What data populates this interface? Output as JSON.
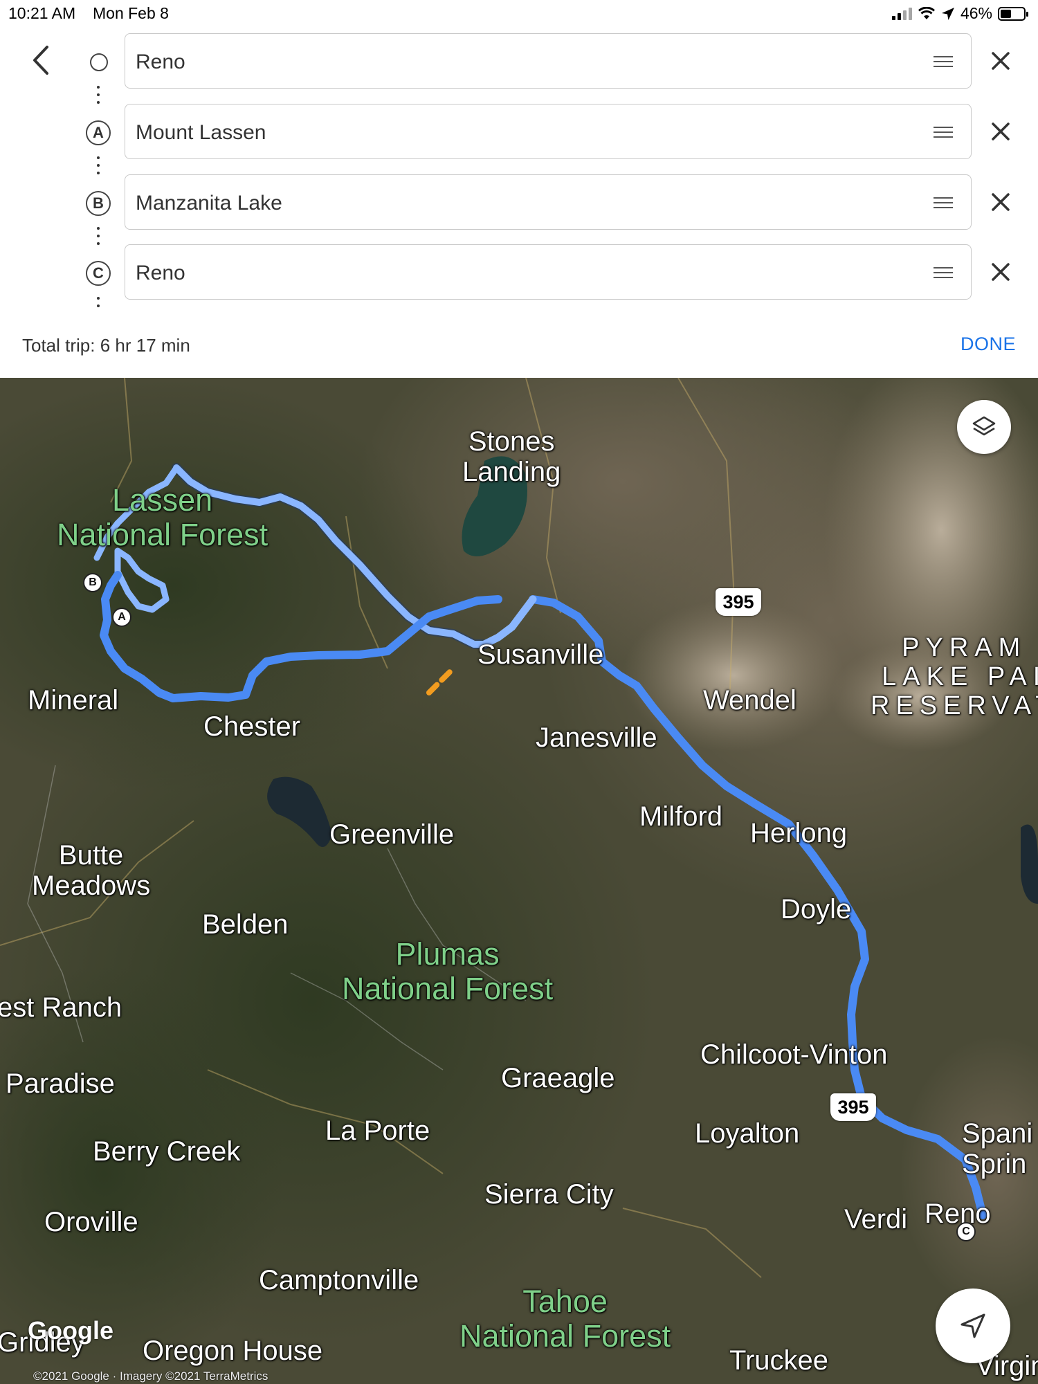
{
  "status_bar": {
    "time": "10:21 AM",
    "date": "Mon Feb 8",
    "battery": "46%",
    "battery_level": 0.46
  },
  "route": {
    "stops": [
      {
        "marker": "",
        "value": "Reno"
      },
      {
        "marker": "A",
        "value": "Mount Lassen"
      },
      {
        "marker": "B",
        "value": "Manzanita Lake"
      },
      {
        "marker": "C",
        "value": "Reno"
      }
    ],
    "total_trip": "Total trip: 6 hr 17 min",
    "done_label": "DONE"
  },
  "map": {
    "places": {
      "stones_landing": "Stones\nLanding",
      "lassen_nf": "Lassen\nNational Forest",
      "susanville": "Susanville",
      "pyramid_lake": "PYRAM\nLAKE PAI\nRESERVAT",
      "wendel": "Wendel",
      "mineral": "Mineral",
      "chester": "Chester",
      "janesville": "Janesville",
      "milford": "Milford",
      "herlong": "Herlong",
      "greenville": "Greenville",
      "butte_meadows": "Butte\nMeadows",
      "doyle": "Doyle",
      "belden": "Belden",
      "plumas_nf": "Plumas\nNational Forest",
      "forest_ranch": "est Ranch",
      "chilcoot_vinton": "Chilcoot-Vinton",
      "paradise": "Paradise",
      "graeagle": "Graeagle",
      "la_porte": "La Porte",
      "loyalton": "Loyalton",
      "spanish_springs": "Spani\nSprin",
      "berry_creek": "Berry Creek",
      "sierra_city": "Sierra City",
      "verdi": "Verdi",
      "reno": "Reno",
      "oroville": "Oroville",
      "camptonville": "Camptonville",
      "tahoe_nf": "Tahoe\nNational Forest",
      "gridley": "Gridley",
      "oregon_house": "Oregon House",
      "truckee": "Truckee",
      "virginia": "Virgini"
    },
    "highway_shields": [
      "395",
      "395"
    ],
    "pins": [
      "A",
      "B",
      "C"
    ],
    "attribution_logo": "Google",
    "copyright": "©2021 Google · Imagery ©2021 TerraMetrics"
  },
  "icons": {
    "back": "chevron-left-icon",
    "drag": "drag-handle-icon",
    "remove": "close-icon",
    "layers": "layers-icon",
    "locate": "navigation-arrow-icon"
  },
  "colors": {
    "route": "#4285f4",
    "route_light": "#7fb2ff",
    "done": "#1a73e8",
    "forest_label": "#7fd089"
  }
}
